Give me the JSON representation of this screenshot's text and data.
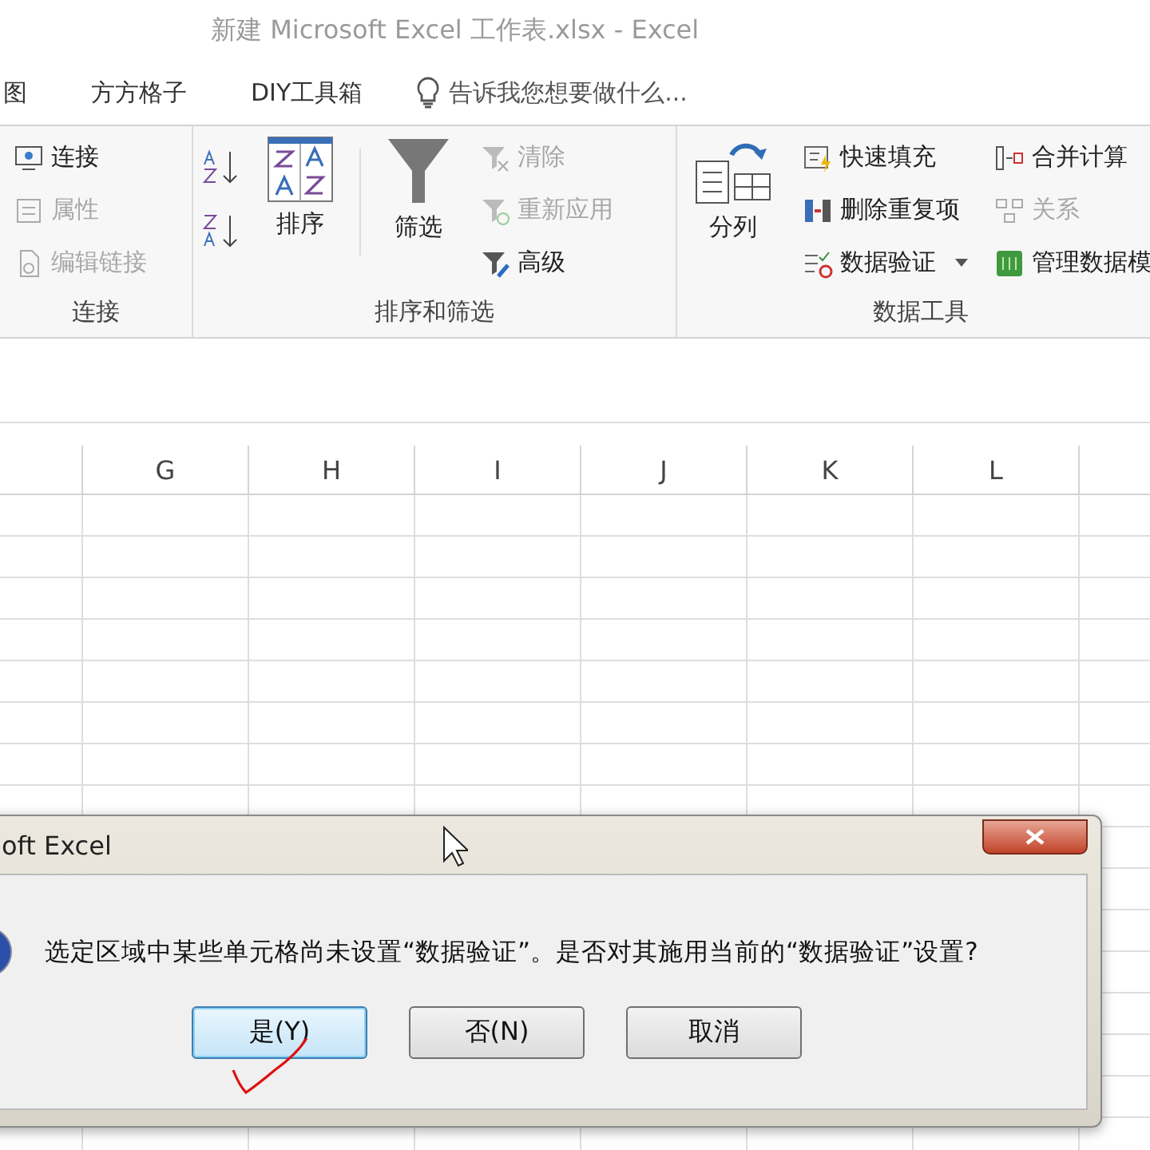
{
  "window": {
    "title": "新建 Microsoft Excel 工作表.xlsx - Excel"
  },
  "menu": {
    "tabs": [
      {
        "label": "图"
      },
      {
        "label": "方方格子"
      },
      {
        "label": "DIY工具箱"
      }
    ],
    "tell_me": "告诉我您想要做什么..."
  },
  "ribbon": {
    "groups": [
      {
        "label": "连接",
        "columns": [
          {
            "kind": "stack",
            "items": [
              {
                "label": "连接",
                "disabled": false
              },
              {
                "label": "属性",
                "disabled": true
              },
              {
                "label": "编辑链接",
                "disabled": true
              }
            ]
          }
        ]
      },
      {
        "label": "排序和筛选",
        "columns": [
          {
            "kind": "icons"
          },
          {
            "kind": "large",
            "label": "排序"
          },
          {
            "kind": "large",
            "label": "筛选"
          },
          {
            "kind": "stack",
            "items": [
              {
                "label": "清除",
                "disabled": true
              },
              {
                "label": "重新应用",
                "disabled": true
              },
              {
                "label": "高级",
                "disabled": false
              }
            ]
          }
        ]
      },
      {
        "label": "数据工具",
        "columns": [
          {
            "kind": "large",
            "label": "分列"
          },
          {
            "kind": "stack",
            "items": [
              {
                "label": "快速填充",
                "disabled": false
              },
              {
                "label": "删除重复项",
                "disabled": false
              },
              {
                "label": "数据验证",
                "disabled": false,
                "dropdown": true
              }
            ]
          },
          {
            "kind": "stack",
            "items": [
              {
                "label": "合并计算",
                "disabled": false
              },
              {
                "label": "关系",
                "disabled": true
              },
              {
                "label": "管理数据模",
                "disabled": false
              }
            ]
          }
        ]
      }
    ]
  },
  "sheet": {
    "columns": [
      "G",
      "H",
      "I",
      "J",
      "K",
      "L"
    ]
  },
  "dialog": {
    "title": "oft Excel",
    "message": "选定区域中某些单元格尚未设置“数据验证”。是否对其施用当前的“数据验证”设置?",
    "buttons": [
      {
        "label": "是(Y)",
        "selected": true
      },
      {
        "label": "否(N)",
        "selected": false
      },
      {
        "label": "取消",
        "selected": false
      }
    ]
  }
}
